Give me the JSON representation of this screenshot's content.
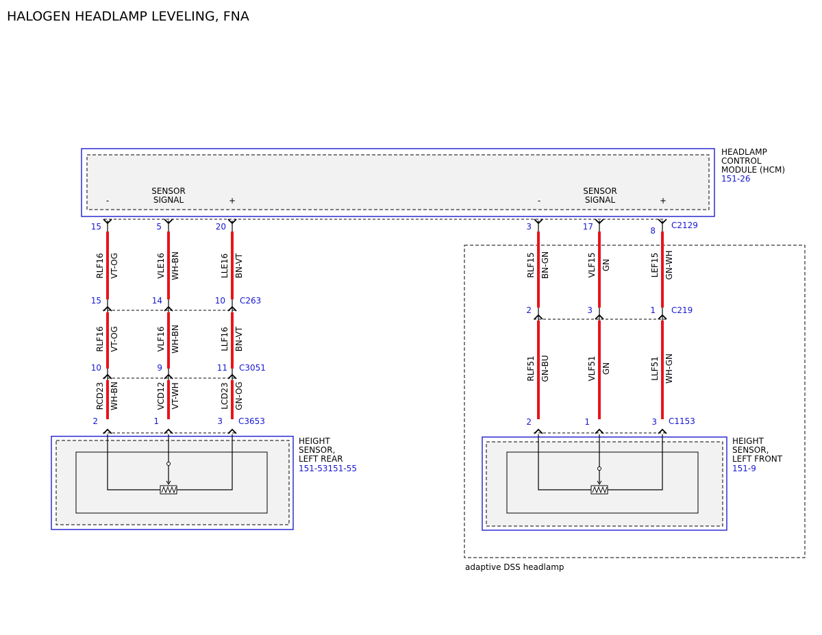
{
  "title": "HALOGEN HEADLAMP LEVELING, FNA",
  "colors": {
    "wire": "#e8131b",
    "module_border": "#2a2ad0",
    "ref_text": "#1515d0",
    "module_fill": "#f2f2f2"
  },
  "hcm": {
    "name_lines": [
      "HEADLAMP",
      "CONTROL",
      "MODULE (HCM)"
    ],
    "ref": "151-26",
    "connector": "C2129",
    "left_group": {
      "minus": "-",
      "signal_lines": [
        "SENSOR",
        "SIGNAL"
      ],
      "plus": "+"
    },
    "right_group": {
      "minus": "-",
      "signal_lines": [
        "SENSOR",
        "SIGNAL"
      ],
      "plus": "+"
    }
  },
  "left_circuit": {
    "connectors": [
      {
        "name": "C263",
        "pins": [
          "15",
          "14",
          "10"
        ]
      },
      {
        "name": "C3051",
        "pins": [
          "10",
          "9",
          "11"
        ]
      },
      {
        "name": "C3653",
        "pins": [
          "2",
          "1",
          "3"
        ]
      }
    ],
    "hcm_pins": [
      "15",
      "5",
      "20"
    ],
    "segments": [
      [
        {
          "circuit": "RLF16",
          "color": "VT-OG"
        },
        {
          "circuit": "VLE16",
          "color": "WH-BN"
        },
        {
          "circuit": "LLE16",
          "color": "BN-VT"
        }
      ],
      [
        {
          "circuit": "RLF16",
          "color": "VT-OG"
        },
        {
          "circuit": "VLF16",
          "color": "WH-BN"
        },
        {
          "circuit": "LLF16",
          "color": "BN-VT"
        }
      ],
      [
        {
          "circuit": "RCD23",
          "color": "WH-BN"
        },
        {
          "circuit": "VCD12",
          "color": "VT-WH"
        },
        {
          "circuit": "LCD23",
          "color": "GN-OG"
        }
      ]
    ],
    "sensor": {
      "name_lines": [
        "HEIGHT",
        "SENSOR,",
        "LEFT REAR"
      ],
      "ref": "151-53151-55"
    }
  },
  "right_circuit": {
    "hcm_pins": [
      "3",
      "17",
      "8"
    ],
    "connectors": [
      {
        "name": "C219",
        "pins": [
          "2",
          "3",
          "1"
        ]
      },
      {
        "name": "C1153",
        "pins": [
          "2",
          "1",
          "3"
        ]
      }
    ],
    "segments": [
      [
        {
          "circuit": "RLF15",
          "color": "BN-GN"
        },
        {
          "circuit": "VLF15",
          "color": "GN"
        },
        {
          "circuit": "LEF15",
          "color": "GN-WH"
        }
      ],
      [
        {
          "circuit": "RLF51",
          "color": "GN-BU"
        },
        {
          "circuit": "VLF51",
          "color": "GN"
        },
        {
          "circuit": "LLF51",
          "color": "WH-GN"
        }
      ]
    ],
    "sensor": {
      "name_lines": [
        "HEIGHT",
        "SENSOR,",
        "LEFT FRONT"
      ],
      "ref": "151-9"
    },
    "option_box_label": "adaptive DSS headlamp"
  }
}
